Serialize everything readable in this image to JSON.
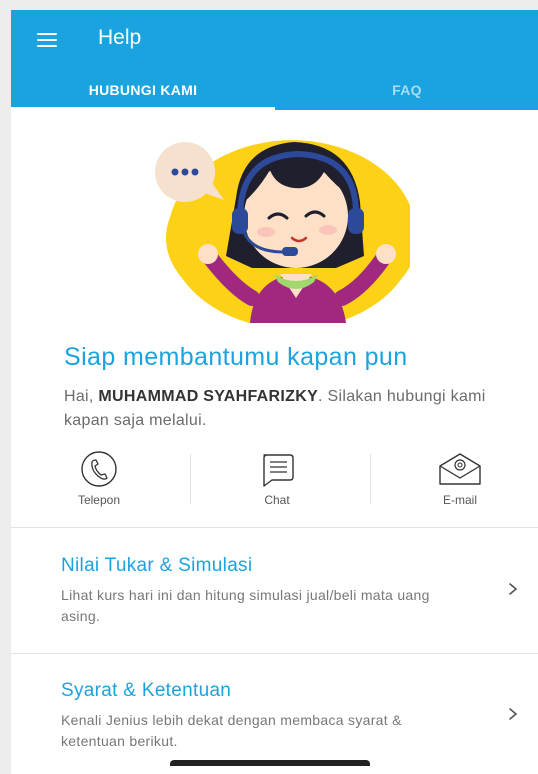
{
  "header": {
    "title": "Help",
    "menu_icon": "hamburger-menu-icon",
    "background": "#1aa3df"
  },
  "tabs": [
    {
      "label": "HUBUNGI KAMI",
      "active": true
    },
    {
      "label": "FAQ",
      "active": false
    }
  ],
  "hero": {
    "illustration": "customer-service-agent-illustration",
    "headline": "Siap membantumu kapan pun",
    "greeting_prefix": "Hai, ",
    "user_name": "MUHAMMAD SYAHFARIZKY",
    "greeting_suffix": ". Silakan hubungi kami kapan saja melalui."
  },
  "contacts": [
    {
      "label": "Telepon",
      "icon": "phone-icon"
    },
    {
      "label": "Chat",
      "icon": "chat-icon"
    },
    {
      "label": "E-mail",
      "icon": "email-icon"
    }
  ],
  "sections": [
    {
      "title": "Nilai Tukar & Simulasi",
      "description": "Lihat kurs hari ini dan hitung simulasi jual/beli mata uang asing."
    },
    {
      "title": "Syarat & Ketentuan",
      "description": "Kenali Jenius lebih dekat dengan membaca syarat & ketentuan berikut."
    }
  ],
  "colors": {
    "accent": "#1aa3df",
    "text_muted": "#777777",
    "divider": "#e2e2e2"
  }
}
